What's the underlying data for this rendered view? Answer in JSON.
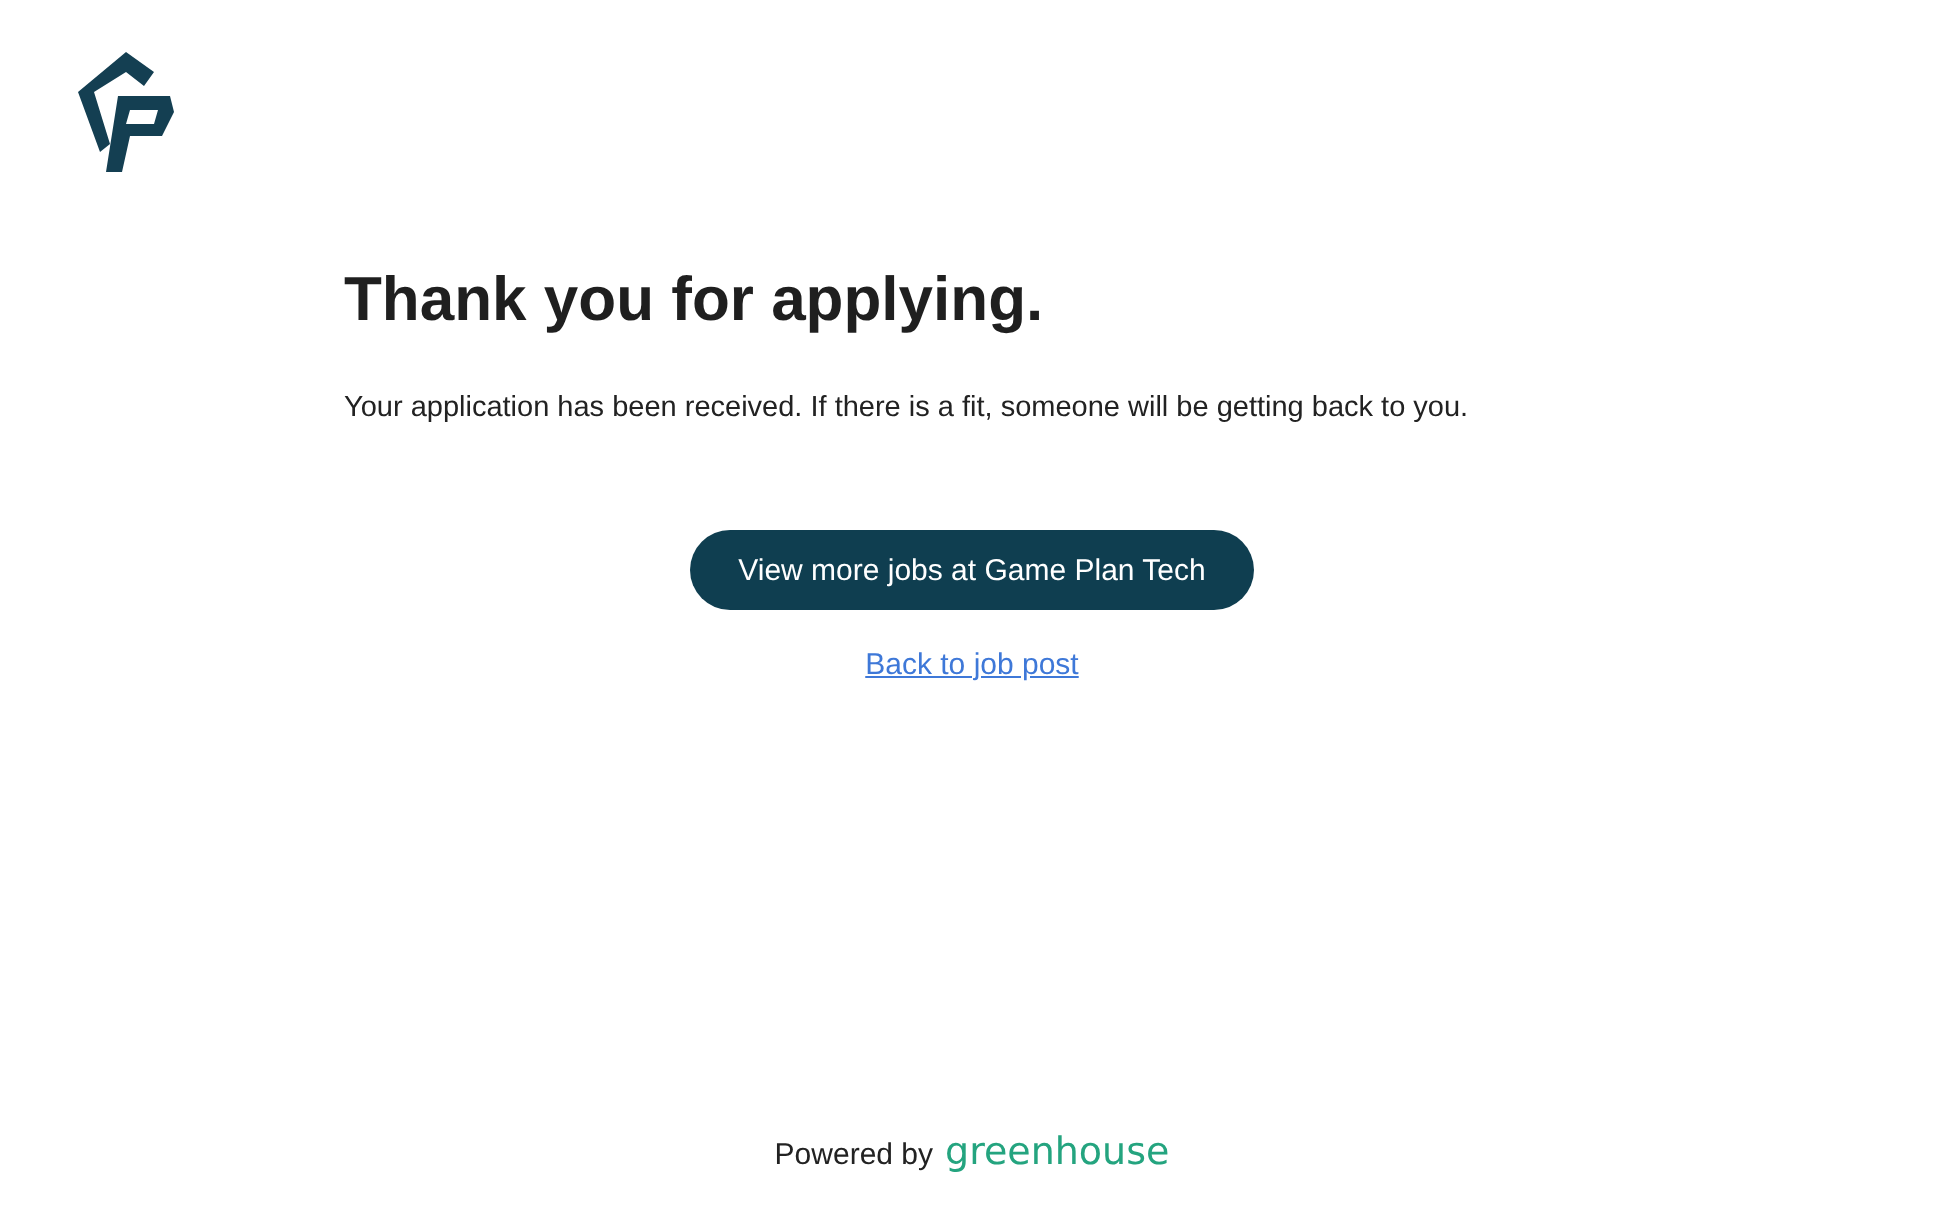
{
  "heading": "Thank you for applying.",
  "message": "Your application has been received. If there is a fit, someone will be getting back to you.",
  "primary_button": "View more jobs at Game Plan Tech",
  "back_link": "Back to job post",
  "footer": {
    "prefix": "Powered by",
    "brand": "greenhouse"
  }
}
